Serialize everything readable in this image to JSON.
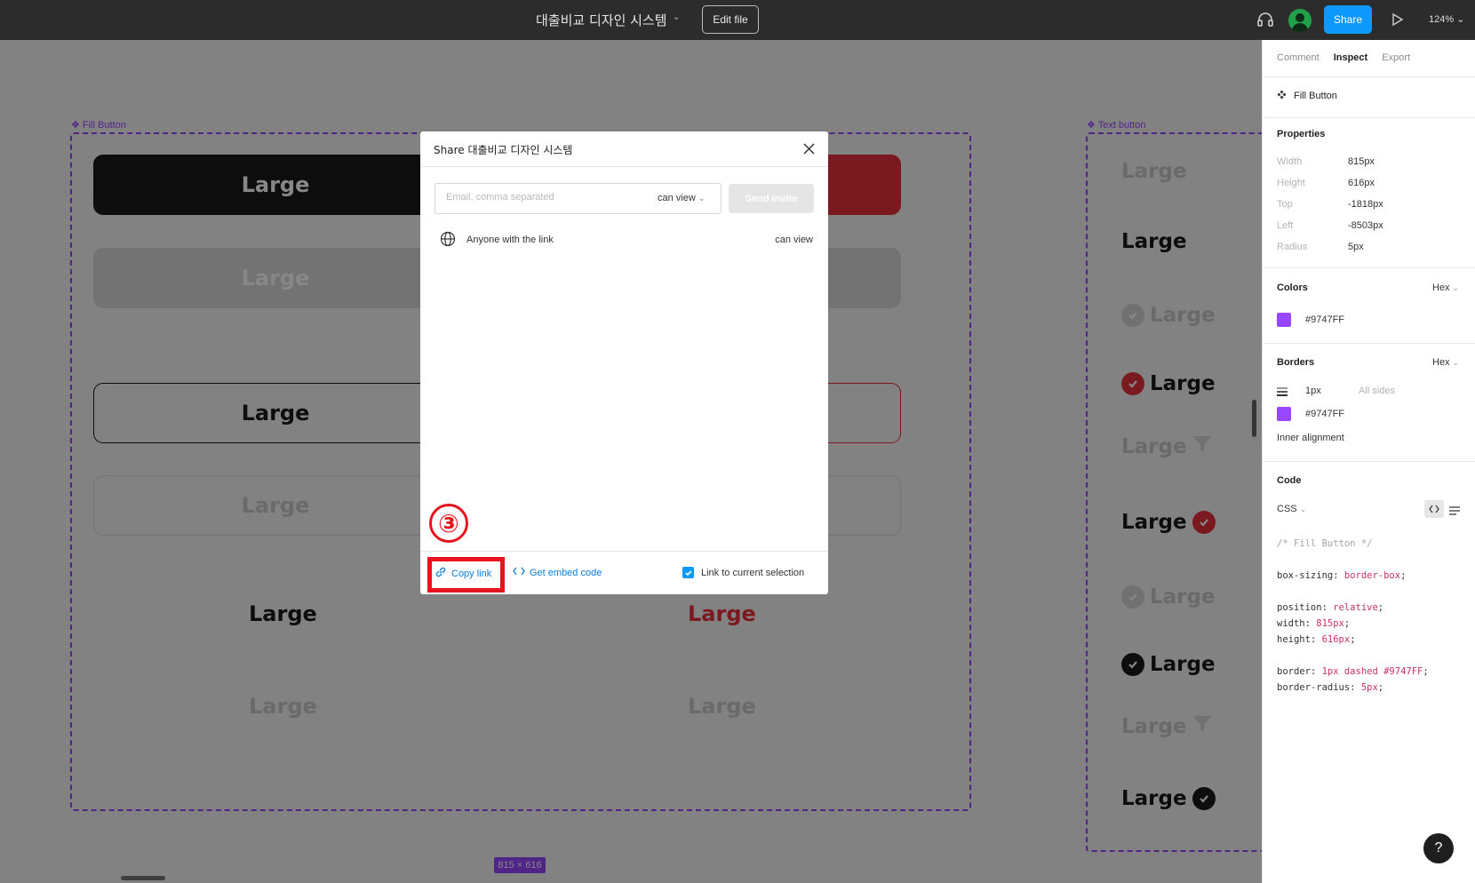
{
  "topbar": {
    "title": "대출비교 디자인 시스템",
    "edit_file": "Edit file",
    "share": "Share",
    "zoom": "124%"
  },
  "canvas": {
    "fill_frame_label": "Fill Button",
    "text_frame_label": "Text button",
    "size_badge": "815 × 616",
    "button_label": "Large",
    "colors": {
      "frame": "#9747FF",
      "black": "#1a1a1a",
      "red": "#e8303d"
    }
  },
  "modal": {
    "title": "Share 대출비교 디자인 시스템",
    "email_placeholder": "Email, comma separated",
    "permission": "can view",
    "send_invite": "Send invite",
    "anyone_text": "Anyone with the link",
    "anyone_perm": "can view",
    "copy_link": "Copy link",
    "embed": "Get embed code",
    "link_selection": "Link to current selection",
    "link_selection_checked": true
  },
  "annotation": {
    "number": "③",
    "color": "#e5141f"
  },
  "panel": {
    "tabs": [
      "Comment",
      "Inspect",
      "Export"
    ],
    "active_tab": "Inspect",
    "selection_name": "Fill Button",
    "properties_title": "Properties",
    "properties": [
      {
        "label": "Width",
        "value": "815px"
      },
      {
        "label": "Height",
        "value": "616px"
      },
      {
        "label": "Top",
        "value": "-1818px"
      },
      {
        "label": "Left",
        "value": "-8503px"
      },
      {
        "label": "Radius",
        "value": "5px"
      }
    ],
    "colors_title": "Colors",
    "color_format": "Hex",
    "color_value": "#9747FF",
    "borders_title": "Borders",
    "border_format": "Hex",
    "border_width": "1px",
    "border_sides": "All sides",
    "border_color": "#9747FF",
    "inner_alignment": "Inner alignment",
    "code_title": "Code",
    "code_lang": "CSS",
    "code": {
      "comment": "/* Fill Button */",
      "l1_prop": "box-sizing: ",
      "l1_val": "border-box",
      "l2_prop": "position: ",
      "l2_val": "relative",
      "l3_prop": "width: ",
      "l3_val": "815px",
      "l4_prop": "height: ",
      "l4_val": "616px",
      "l5_prop": "border: ",
      "l5_val": "1px dashed #9747FF",
      "l6_prop": "border-radius: ",
      "l6_val": "5px"
    },
    "help": "?"
  }
}
